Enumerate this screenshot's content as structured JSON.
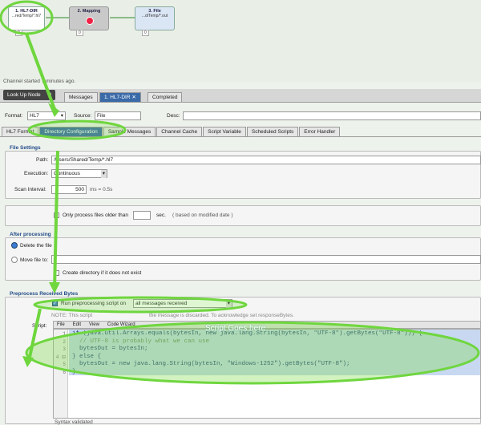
{
  "flow": {
    "nodes": [
      {
        "title": "1. HL7-DIR",
        "path": "...red/Temp/*.hl7",
        "badge": "0"
      },
      {
        "title": "2. Mapping",
        "path": "",
        "badge": "0"
      },
      {
        "title": "3. File",
        "path": "...d/Temp/*.out",
        "badge": "0"
      }
    ],
    "status": "Channel started 7 minutes ago."
  },
  "top_tabs": {
    "lookup": "Look Up Node",
    "lookup_count": "0",
    "messages": "Messages",
    "active": "1. HL7-DIR",
    "completed": "Completed"
  },
  "format": {
    "label": "Format:",
    "value": "HL7",
    "source_label": "Source:",
    "source_value": "File",
    "desc_label": "Desc:"
  },
  "sub_tabs": [
    "HL7 Format",
    "Directory Configuration",
    "Sample Messages",
    "Channel Cache",
    "Script Variable",
    "Scheduled Scripts",
    "Error Handler"
  ],
  "file_settings": {
    "title": "File Settings",
    "path_label": "Path:",
    "path_value": "/Users/Shared/Temp/*.hl7",
    "execution_label": "Execution:",
    "execution_value": "Continuous",
    "interval_label": "Scan Interval:",
    "interval_value": "500",
    "interval_hint": "ms = 0.5s",
    "older_label": "Only process files older than",
    "older_unit": "sec.",
    "older_hint": "( based on modified date )"
  },
  "after": {
    "title": "After processing",
    "delete": "Delete the file",
    "move": "Move file to:",
    "create_dir": "Create directory if it does not exist"
  },
  "preprocess": {
    "title": "Preprocess Received Bytes",
    "run_label": "Run preprocessing script on",
    "run_value": "all messages received",
    "note_left": "NOTE: This script",
    "note_right": "the message is discarded. To acknowledge set responseBytes.",
    "script_label": "Script:",
    "menu": [
      "File",
      "Edit",
      "View",
      "Code Wizard"
    ],
    "annotation": "Script Goes here",
    "lines": [
      "if (java.util.Arrays.equals(bytesIn, new java.lang.String(bytesIn, \"UTF-8\").getBytes(\"UTF-8\"))) {",
      "  // UTF-8 is probably what we can use",
      "  bytesOut = bytesIn;",
      "} else {",
      "  bytesOut = new java.lang.String(bytesIn, \"Windows-1252\").getBytes(\"UTF-8\");",
      "}"
    ],
    "status": "Syntax validated"
  },
  "colors": {
    "highlight": "#7ddc4a",
    "active_tab": "#3a6aa8",
    "code_bg": "#c8d8f0"
  }
}
